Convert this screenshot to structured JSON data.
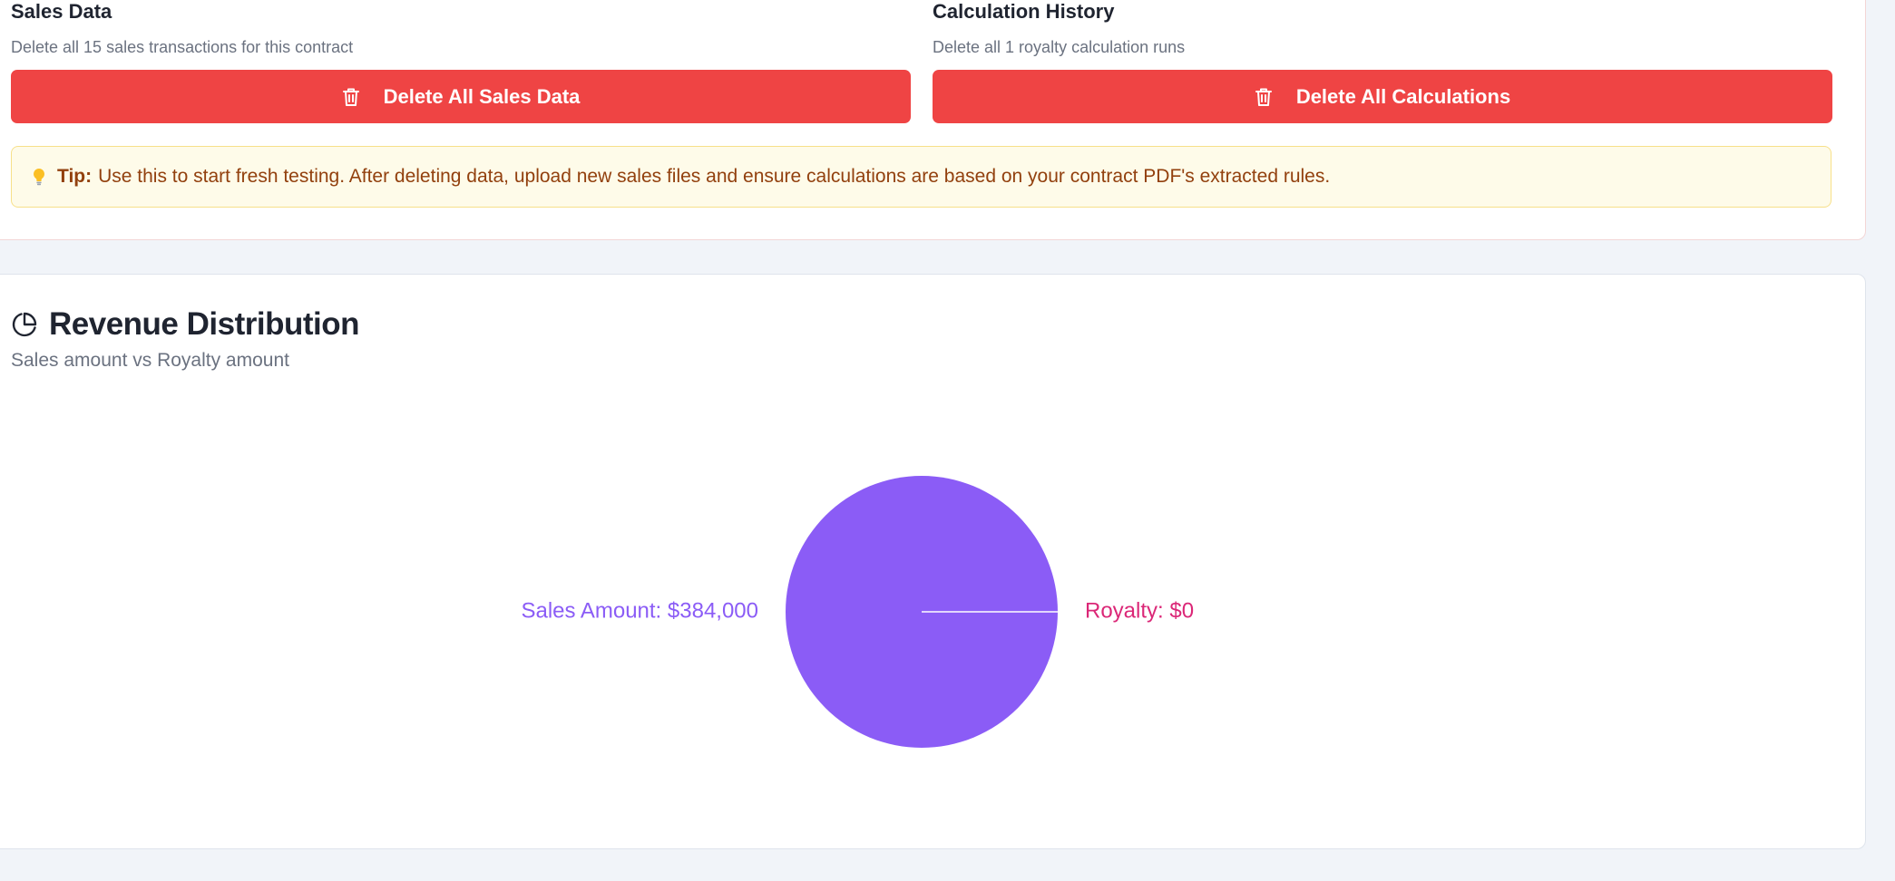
{
  "danger": {
    "sales": {
      "title": "Sales Data",
      "desc": "Delete all 15 sales transactions for this contract",
      "button_label": "Delete All Sales Data"
    },
    "history": {
      "title": "Calculation History",
      "desc": "Delete all 1 royalty calculation runs",
      "button_label": "Delete All Calculations"
    },
    "tip": {
      "icon": "lightbulb-icon",
      "label": "Tip:",
      "text": "Use this to start fresh testing. After deleting data, upload new sales files and ensure calculations are based on your contract PDF's extracted rules."
    }
  },
  "chart_section": {
    "icon": "pie-chart-icon",
    "title": "Revenue Distribution",
    "subtitle": "Sales amount vs Royalty amount"
  },
  "chart_data": {
    "type": "pie",
    "slices": [
      {
        "label": "Sales Amount: $384,000",
        "value": 384000,
        "color": "#8b5cf6"
      },
      {
        "label": "Royalty: $0",
        "value": 0,
        "color": "#db2777"
      }
    ]
  },
  "colors": {
    "danger": "#ef4444",
    "tip_bg": "#fefbe9",
    "tip_text": "#92400e",
    "sales_slice": "#8b5cf6",
    "royalty_label": "#db2777"
  }
}
